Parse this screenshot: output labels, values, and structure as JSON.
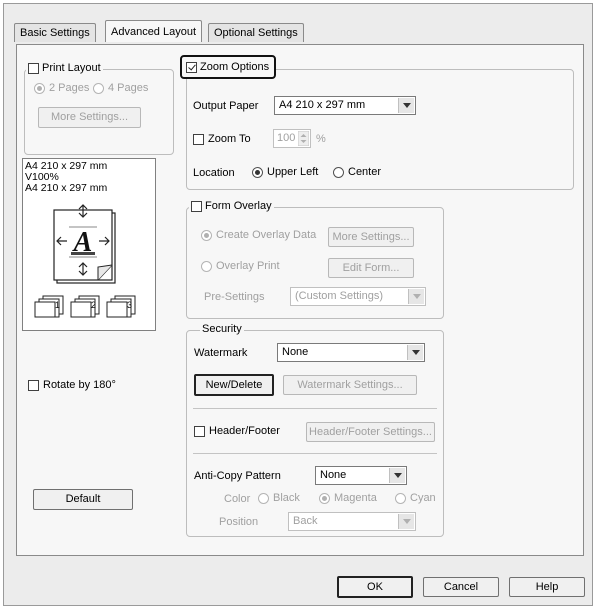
{
  "tabs": {
    "basic": "Basic Settings",
    "advanced": "Advanced Layout",
    "optional": "Optional Settings"
  },
  "print_layout": {
    "label": "Print Layout",
    "checked": false,
    "two_pages": "2 Pages",
    "four_pages": "4 Pages",
    "more_settings": "More Settings..."
  },
  "preview": {
    "line1": "A4 210 x 297 mm",
    "line2": "V100%",
    "line3": "A4 210 x 297 mm",
    "glyph": "A"
  },
  "rotate": {
    "label": "Rotate by 180°",
    "checked": false
  },
  "default_button": "Default",
  "zoom": {
    "label": "Zoom Options",
    "checked": true,
    "output_paper_label": "Output Paper",
    "output_paper_value": "A4 210 x 297 mm",
    "zoom_to_label": "Zoom To",
    "zoom_to_value": "100",
    "percent": "%",
    "location_label": "Location",
    "upper_left": "Upper Left",
    "center": "Center"
  },
  "form_overlay": {
    "label": "Form Overlay",
    "create": "Create Overlay Data",
    "more_settings": "More Settings...",
    "overlay_print": "Overlay Print",
    "edit_form": "Edit Form...",
    "pre_settings_label": "Pre-Settings",
    "pre_settings_value": "(Custom Settings)"
  },
  "security": {
    "title": "Security",
    "watermark_label": "Watermark",
    "watermark_value": "None",
    "new_delete": "New/Delete",
    "watermark_settings": "Watermark Settings...",
    "header_footer_label": "Header/Footer",
    "header_footer_settings": "Header/Footer Settings...",
    "anticopy_label": "Anti-Copy Pattern",
    "anticopy_value": "None",
    "color_label": "Color",
    "black": "Black",
    "magenta": "Magenta",
    "cyan": "Cyan",
    "position_label": "Position",
    "position_value": "Back"
  },
  "footer": {
    "ok": "OK",
    "cancel": "Cancel",
    "help": "Help"
  }
}
